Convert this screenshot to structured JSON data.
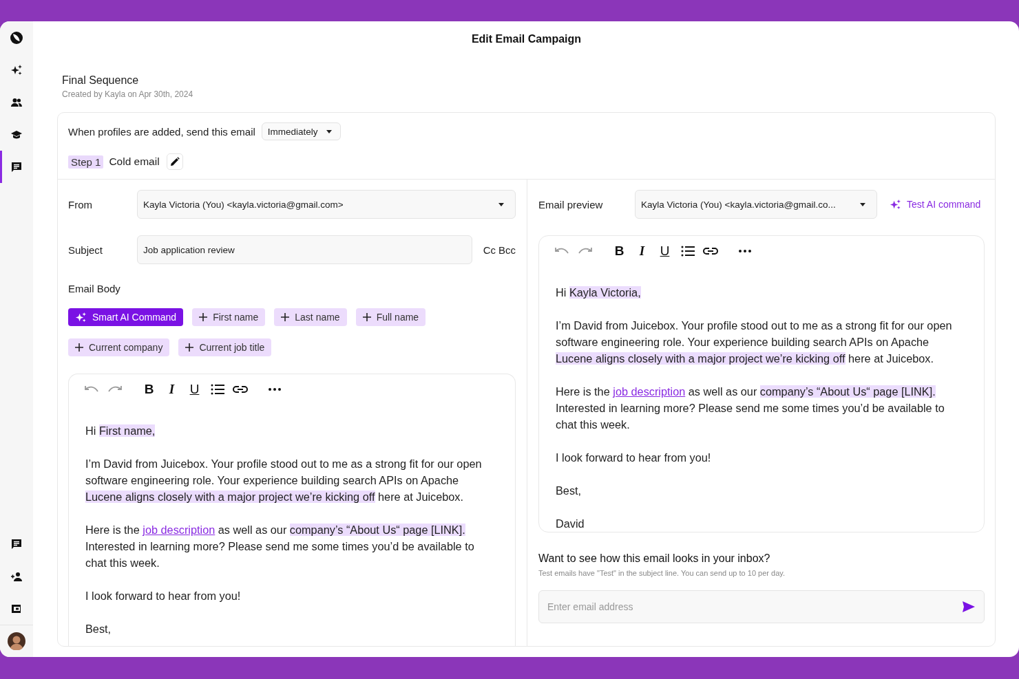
{
  "sidebar": {
    "top": [
      {
        "kind": "logo",
        "selected": false
      },
      {
        "kind": "sparkle",
        "selected": false
      },
      {
        "kind": "people",
        "selected": false
      },
      {
        "kind": "school",
        "selected": false
      },
      {
        "kind": "chat",
        "selected": true
      }
    ],
    "bottom": [
      {
        "kind": "chat",
        "selected": false
      },
      {
        "kind": "person-add",
        "selected": false
      },
      {
        "kind": "wallet",
        "selected": false
      },
      {
        "kind": "avatar",
        "selected": false
      }
    ]
  },
  "page_title": "Edit Email Campaign",
  "sequence": {
    "name": "Final Sequence",
    "created": "Created by Kayla on Apr 30th, 2024"
  },
  "trigger": {
    "label": "When profiles are added, send this email",
    "timing": "Immediately"
  },
  "step": {
    "badge": "Step 1",
    "name": "Cold email"
  },
  "compose": {
    "from_label": "From",
    "from_value": "Kayla Victoria (You) <kayla.victoria@gmail.com>",
    "subject_label": "Subject",
    "subject_value": "Job application review",
    "cc": "Cc",
    "bcc": "Bcc",
    "body_label": "Email Body",
    "chips": [
      {
        "kind": "ai",
        "label": "Smart AI Command"
      },
      {
        "kind": "variable",
        "label": "First name"
      },
      {
        "kind": "variable",
        "label": "Last name"
      },
      {
        "kind": "variable",
        "label": "Full name"
      },
      {
        "kind": "variable",
        "label": "Current company"
      },
      {
        "kind": "variable",
        "label": "Current job title"
      }
    ],
    "toolbar": [
      {
        "kind": "undo",
        "disabled": true
      },
      {
        "kind": "redo",
        "disabled": true
      },
      {
        "kind": "bold",
        "label": "B",
        "disabled": false
      },
      {
        "kind": "italic",
        "label": "I",
        "disabled": false
      },
      {
        "kind": "underline",
        "label": "U",
        "disabled": false
      },
      {
        "kind": "list",
        "disabled": false
      },
      {
        "kind": "link",
        "disabled": false
      },
      {
        "kind": "more",
        "disabled": false
      }
    ],
    "body": [
      {
        "lines": [
          [
            {
              "kind": "text",
              "text": "Hi "
            },
            {
              "kind": "highlight",
              "text": "First name,"
            }
          ]
        ]
      },
      {
        "lines": [
          [
            {
              "kind": "text",
              "text": "I’m David from Juicebox. Your profile stood out to me as a strong fit for our open software engineering role. Your experience building search APIs on Apache "
            },
            {
              "kind": "highlight",
              "text": "Lucene aligns closely with a major project we’re kicking off"
            },
            {
              "kind": "text",
              "text": " here at Juicebox."
            }
          ]
        ]
      },
      {
        "lines": [
          [
            {
              "kind": "text",
              "text": "Here is the "
            },
            {
              "kind": "link",
              "text": "job description"
            },
            {
              "kind": "text",
              "text": " as well as our "
            },
            {
              "kind": "highlight",
              "text": "company’s “About Us“ page [LINK]."
            },
            {
              "kind": "text",
              "text": " Interested in learning more? Please send me some times you’d be available to chat this week."
            }
          ]
        ]
      },
      {
        "lines": [
          [
            {
              "kind": "text",
              "text": "I look forward to hear from you!"
            }
          ]
        ]
      },
      {
        "lines": [
          [
            {
              "kind": "text",
              "text": "Best,"
            }
          ]
        ]
      }
    ]
  },
  "preview": {
    "label": "Email preview",
    "from_value": "Kayla Victoria (You) <kayla.victoria@gmail.co...",
    "test_ai": "Test AI command",
    "toolbar": [
      {
        "kind": "undo",
        "disabled": true
      },
      {
        "kind": "redo",
        "disabled": true
      },
      {
        "kind": "bold",
        "label": "B",
        "disabled": false
      },
      {
        "kind": "italic",
        "label": "I",
        "disabled": false
      },
      {
        "kind": "underline",
        "label": "U",
        "disabled": false
      },
      {
        "kind": "list",
        "disabled": false
      },
      {
        "kind": "link",
        "disabled": false
      },
      {
        "kind": "more",
        "disabled": false
      }
    ],
    "body": [
      {
        "lines": [
          [
            {
              "kind": "text",
              "text": "Hi "
            },
            {
              "kind": "highlight",
              "text": "Kayla Victoria,"
            }
          ]
        ]
      },
      {
        "lines": [
          [
            {
              "kind": "text",
              "text": "I’m David from Juicebox. Your profile stood out to me as a strong fit for our open software engineering role. Your experience building search APIs on Apache "
            },
            {
              "kind": "highlight",
              "text": "Lucene aligns closely with a major project we’re kicking off"
            },
            {
              "kind": "text",
              "text": " here at Juicebox."
            }
          ]
        ]
      },
      {
        "lines": [
          [
            {
              "kind": "text",
              "text": "Here is the "
            },
            {
              "kind": "link",
              "text": "job description"
            },
            {
              "kind": "text",
              "text": " as well as our "
            },
            {
              "kind": "highlight",
              "text": "company’s “About Us“ page [LINK]."
            },
            {
              "kind": "text",
              "text": " Interested in learning more? Please send me some times you’d be available to chat this week."
            }
          ]
        ]
      },
      {
        "lines": [
          [
            {
              "kind": "text",
              "text": "I look forward to hear from you!"
            }
          ]
        ]
      },
      {
        "lines": [
          [
            {
              "kind": "text",
              "text": "Best,"
            }
          ],
          [
            {
              "kind": "text",
              "text": "David"
            }
          ]
        ]
      }
    ]
  },
  "test": {
    "title": "Want to see how this email looks in your inbox?",
    "note": "Test emails have \"Test\" in the subject line. You can send up to 10 per day.",
    "placeholder": "Enter email address"
  }
}
